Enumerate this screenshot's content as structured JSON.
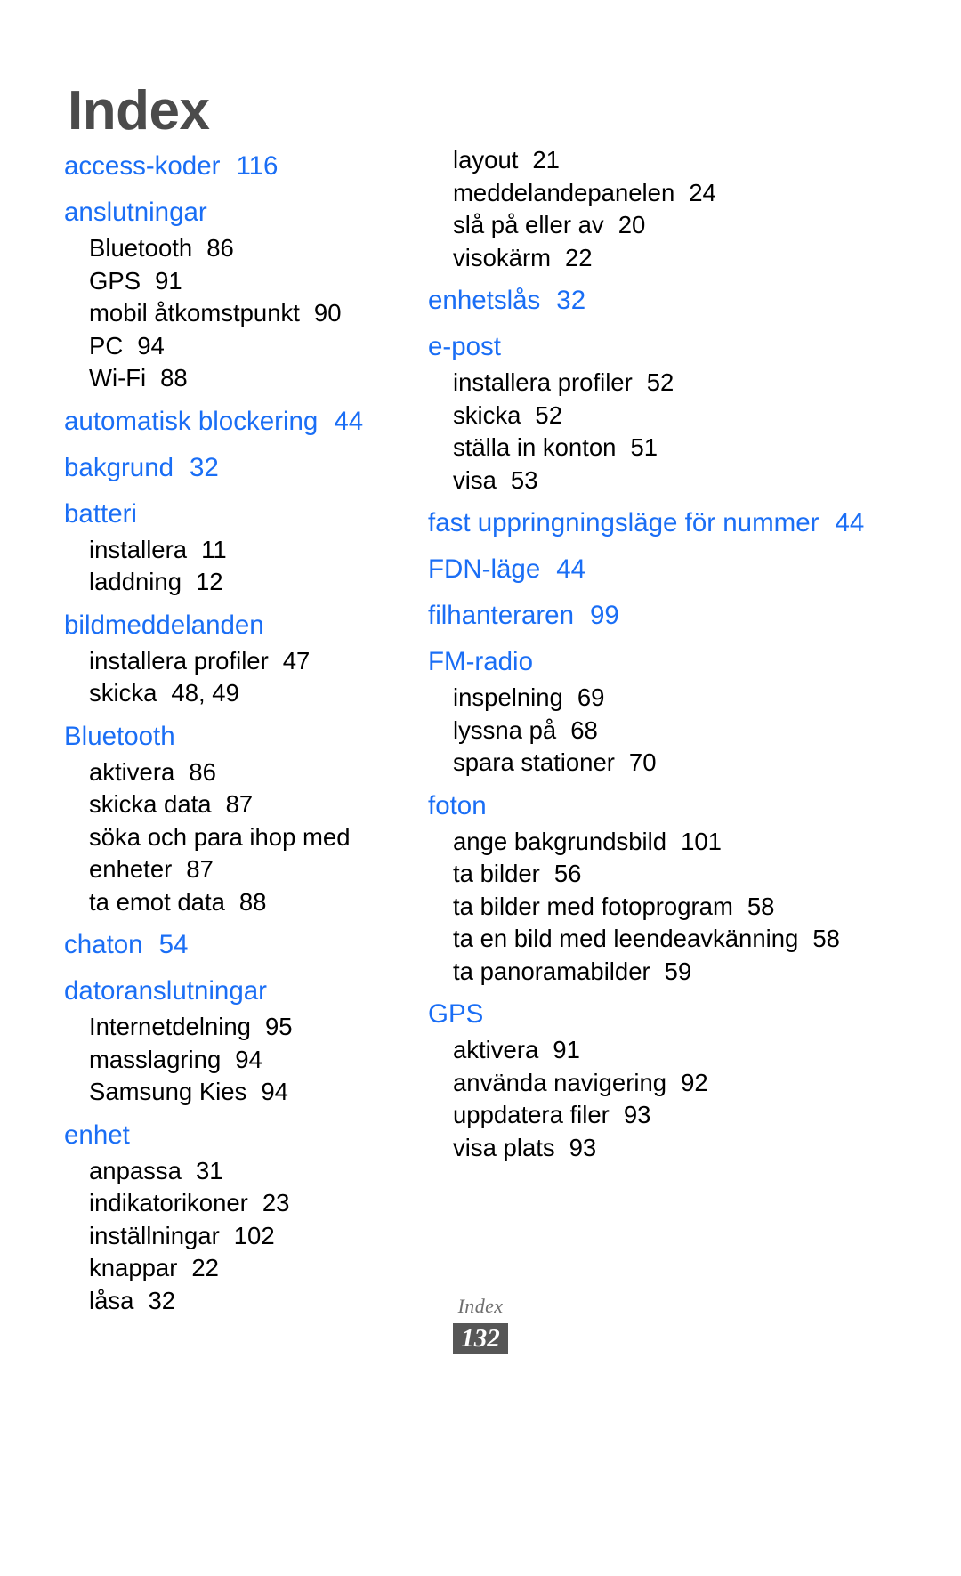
{
  "page": {
    "title": "Index",
    "footer_label": "Index",
    "page_number": "132",
    "accent_color": "#1a6ef5",
    "title_color": "#4b4b4b",
    "badge_color": "#575757"
  },
  "left_column": [
    {
      "type": "main",
      "label": "access-koder",
      "pages": "116"
    },
    {
      "type": "main",
      "label": "anslutningar",
      "pages": ""
    },
    {
      "type": "sub",
      "label": "Bluetooth",
      "pages": "86"
    },
    {
      "type": "sub",
      "label": "GPS",
      "pages": "91"
    },
    {
      "type": "sub",
      "label": "mobil åtkomstpunkt",
      "pages": "90"
    },
    {
      "type": "sub",
      "label": "PC",
      "pages": "94"
    },
    {
      "type": "sub",
      "label": "Wi-Fi",
      "pages": "88"
    },
    {
      "type": "main",
      "label": "automatisk blockering",
      "pages": "44"
    },
    {
      "type": "main",
      "label": "bakgrund",
      "pages": "32"
    },
    {
      "type": "main",
      "label": "batteri",
      "pages": ""
    },
    {
      "type": "sub",
      "label": "installera",
      "pages": "11"
    },
    {
      "type": "sub",
      "label": "laddning",
      "pages": "12"
    },
    {
      "type": "main",
      "label": "bildmeddelanden",
      "pages": ""
    },
    {
      "type": "sub",
      "label": "installera profiler",
      "pages": "47"
    },
    {
      "type": "sub",
      "label": "skicka",
      "pages": "48, 49"
    },
    {
      "type": "main",
      "label": "Bluetooth",
      "pages": ""
    },
    {
      "type": "sub",
      "label": "aktivera",
      "pages": "86"
    },
    {
      "type": "sub",
      "label": "skicka data",
      "pages": "87"
    },
    {
      "type": "sub",
      "label": "söka och para ihop med enheter",
      "pages": "87",
      "wrap": true
    },
    {
      "type": "sub",
      "label": "ta emot data",
      "pages": "88"
    },
    {
      "type": "main",
      "label": "chaton",
      "pages": "54"
    },
    {
      "type": "main",
      "label": "datoranslutningar",
      "pages": ""
    },
    {
      "type": "sub",
      "label": "Internetdelning",
      "pages": "95"
    },
    {
      "type": "sub",
      "label": "masslagring",
      "pages": "94"
    },
    {
      "type": "sub",
      "label": "Samsung Kies",
      "pages": "94"
    },
    {
      "type": "main",
      "label": "enhet",
      "pages": ""
    },
    {
      "type": "sub",
      "label": "anpassa",
      "pages": "31"
    },
    {
      "type": "sub",
      "label": "indikatorikoner",
      "pages": "23"
    },
    {
      "type": "sub",
      "label": "inställningar",
      "pages": "102"
    },
    {
      "type": "sub",
      "label": "knappar",
      "pages": "22"
    },
    {
      "type": "sub",
      "label": "låsa",
      "pages": "32"
    }
  ],
  "right_column": [
    {
      "type": "sub",
      "label": "layout",
      "pages": "21"
    },
    {
      "type": "sub",
      "label": "meddelandepanelen",
      "pages": "24"
    },
    {
      "type": "sub",
      "label": "slå på eller av",
      "pages": "20"
    },
    {
      "type": "sub",
      "label": "visokärm",
      "pages": "22"
    },
    {
      "type": "main",
      "label": "enhetslås",
      "pages": "32"
    },
    {
      "type": "main",
      "label": "e-post",
      "pages": ""
    },
    {
      "type": "sub",
      "label": "installera profiler",
      "pages": "52"
    },
    {
      "type": "sub",
      "label": "skicka",
      "pages": "52"
    },
    {
      "type": "sub",
      "label": "ställa in konton",
      "pages": "51"
    },
    {
      "type": "sub",
      "label": "visa",
      "pages": "53"
    },
    {
      "type": "main",
      "label": "fast uppringningsläge för nummer",
      "pages": "44",
      "wrap": true
    },
    {
      "type": "main",
      "label": "FDN-läge",
      "pages": "44"
    },
    {
      "type": "main",
      "label": "filhanteraren",
      "pages": "99"
    },
    {
      "type": "main",
      "label": "FM-radio",
      "pages": ""
    },
    {
      "type": "sub",
      "label": "inspelning",
      "pages": "69"
    },
    {
      "type": "sub",
      "label": "lyssna på",
      "pages": "68"
    },
    {
      "type": "sub",
      "label": "spara stationer",
      "pages": "70"
    },
    {
      "type": "main",
      "label": "foton",
      "pages": ""
    },
    {
      "type": "sub",
      "label": "ange bakgrundsbild",
      "pages": "101"
    },
    {
      "type": "sub",
      "label": "ta bilder",
      "pages": "56"
    },
    {
      "type": "sub",
      "label": "ta bilder med fotoprogram",
      "pages": "58",
      "wrap": true
    },
    {
      "type": "sub",
      "label": "ta en bild med leendeavkänning",
      "pages": "58",
      "wrap": true
    },
    {
      "type": "sub",
      "label": "ta panoramabilder",
      "pages": "59"
    },
    {
      "type": "main",
      "label": "GPS",
      "pages": ""
    },
    {
      "type": "sub",
      "label": "aktivera",
      "pages": "91"
    },
    {
      "type": "sub",
      "label": "använda navigering",
      "pages": "92"
    },
    {
      "type": "sub",
      "label": "uppdatera filer",
      "pages": "93"
    },
    {
      "type": "sub",
      "label": "visa plats",
      "pages": "93"
    }
  ]
}
